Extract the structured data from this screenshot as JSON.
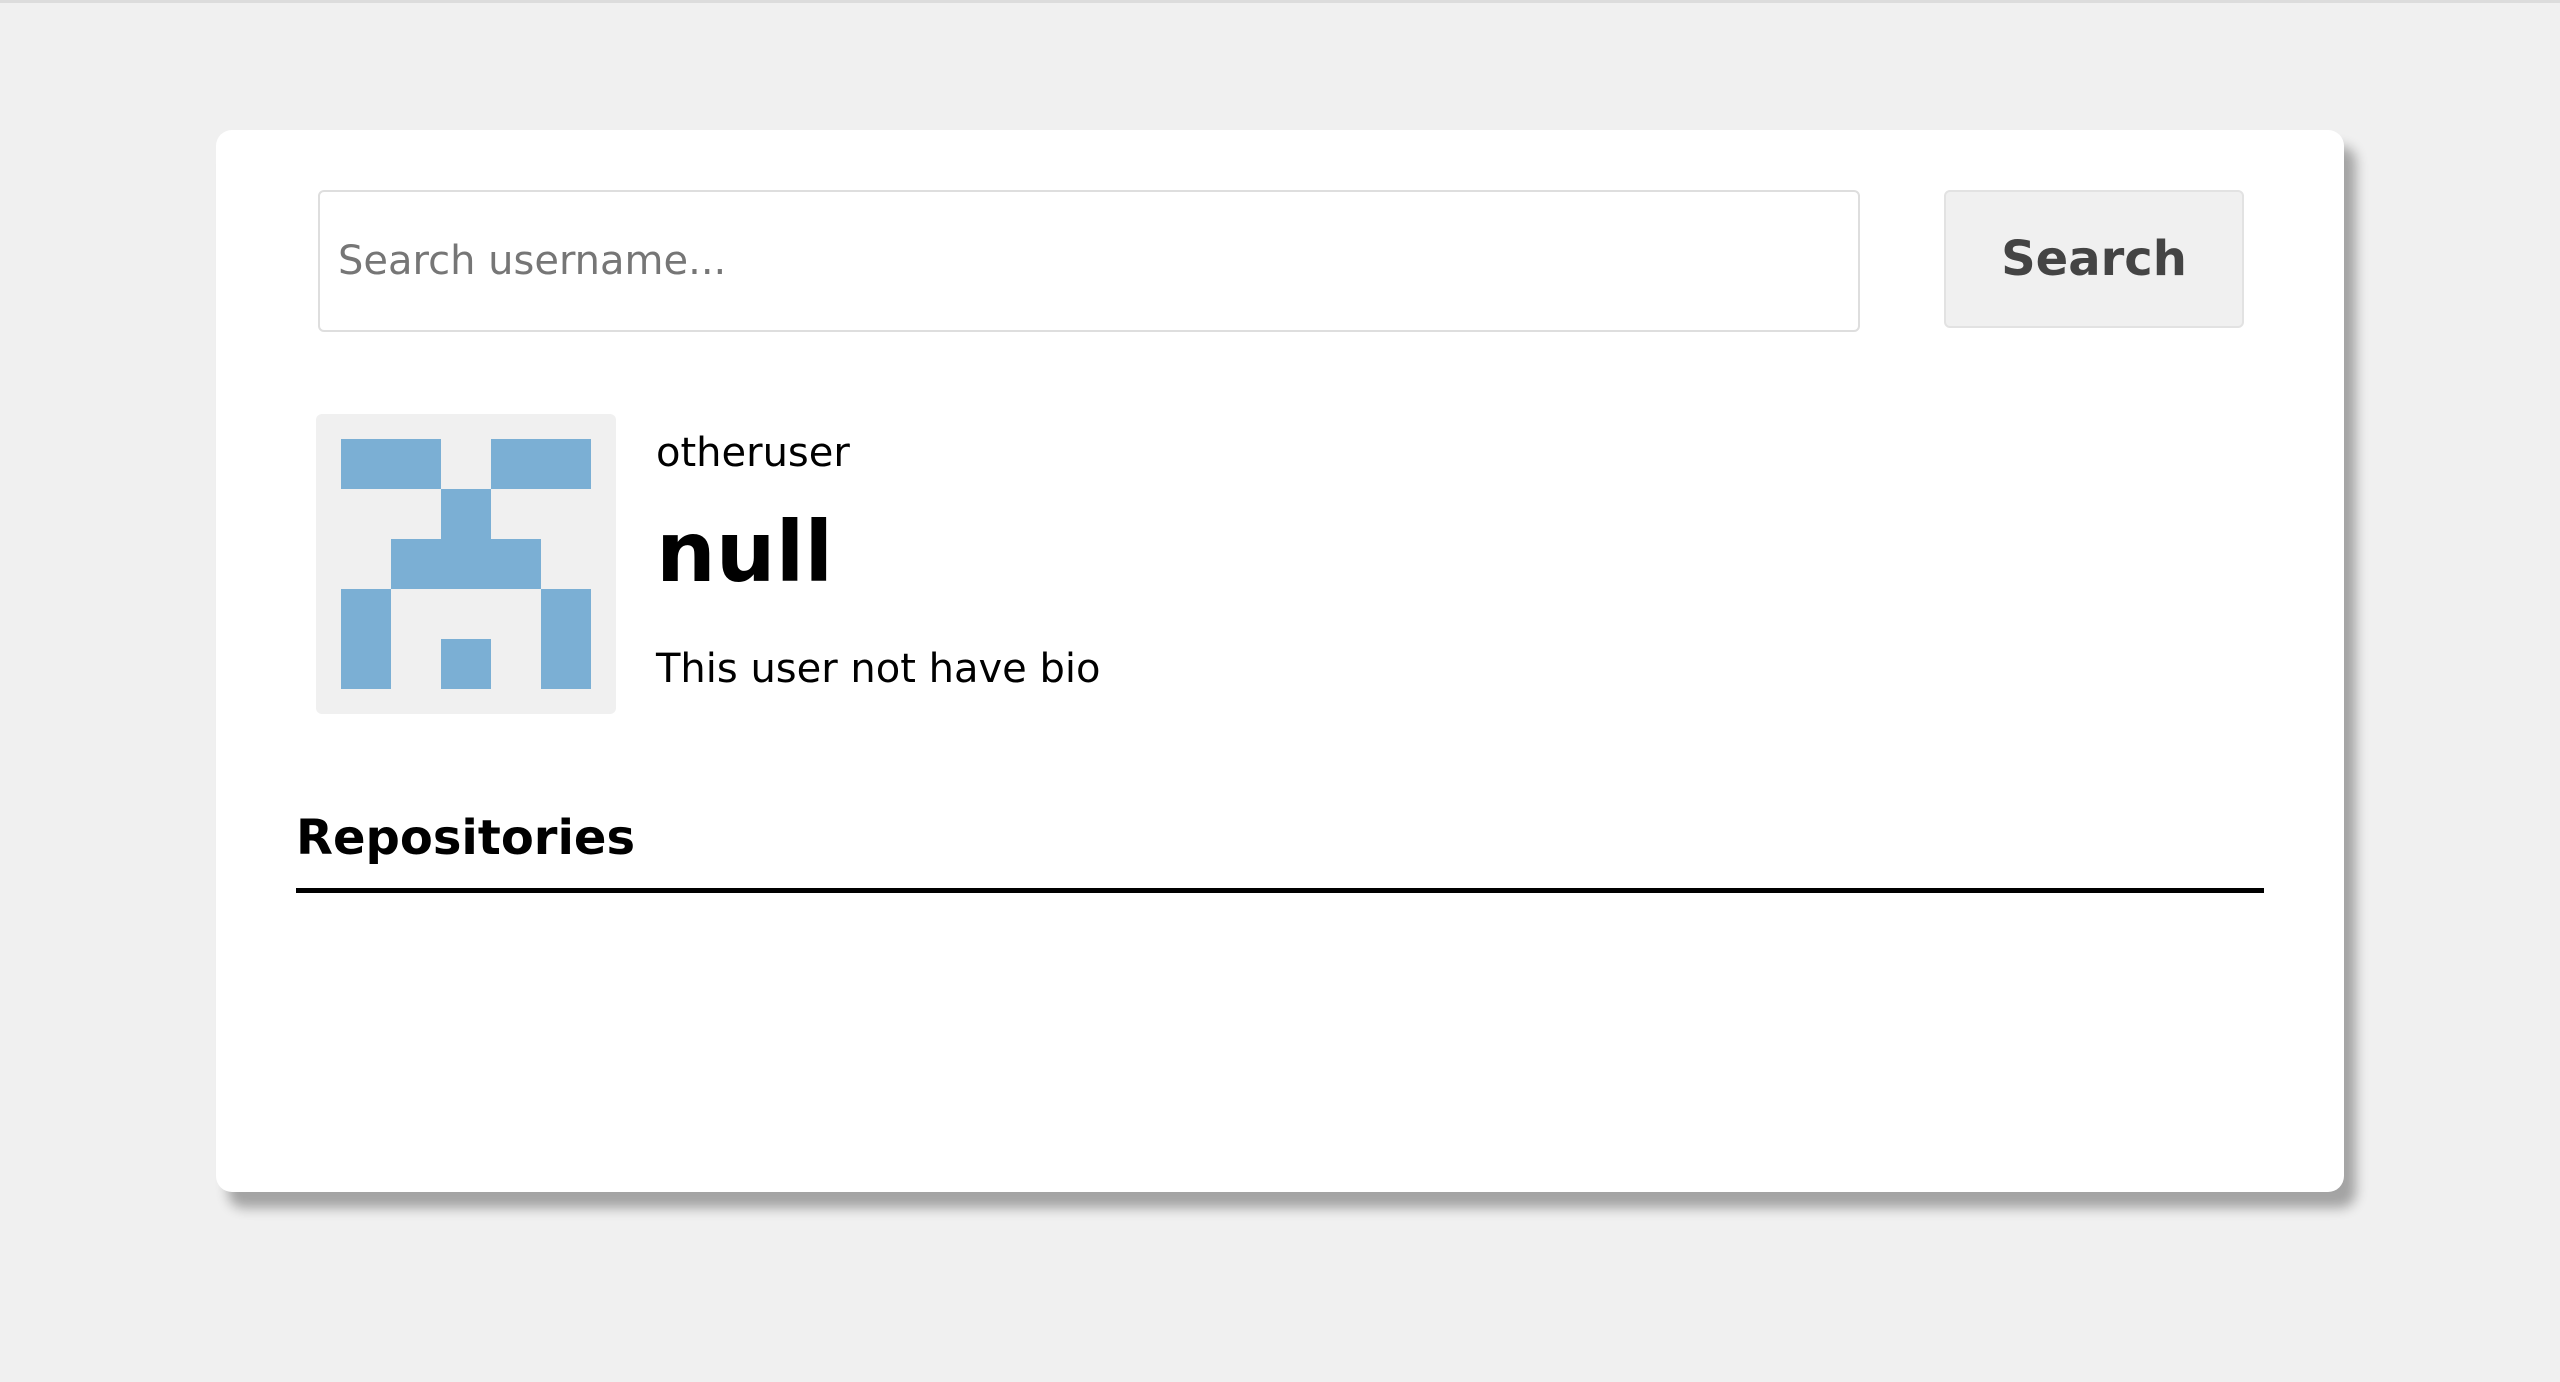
{
  "search": {
    "placeholder": "Search username...",
    "value": "",
    "button_label": "Search"
  },
  "profile": {
    "avatar_icon": "identicon-avatar",
    "avatar_color": "#7bafd4",
    "avatar_background": "#f0f0f0",
    "login": "otheruser",
    "name": "null",
    "bio": "This user not have bio"
  },
  "repositories": {
    "heading": "Repositories",
    "items": []
  }
}
